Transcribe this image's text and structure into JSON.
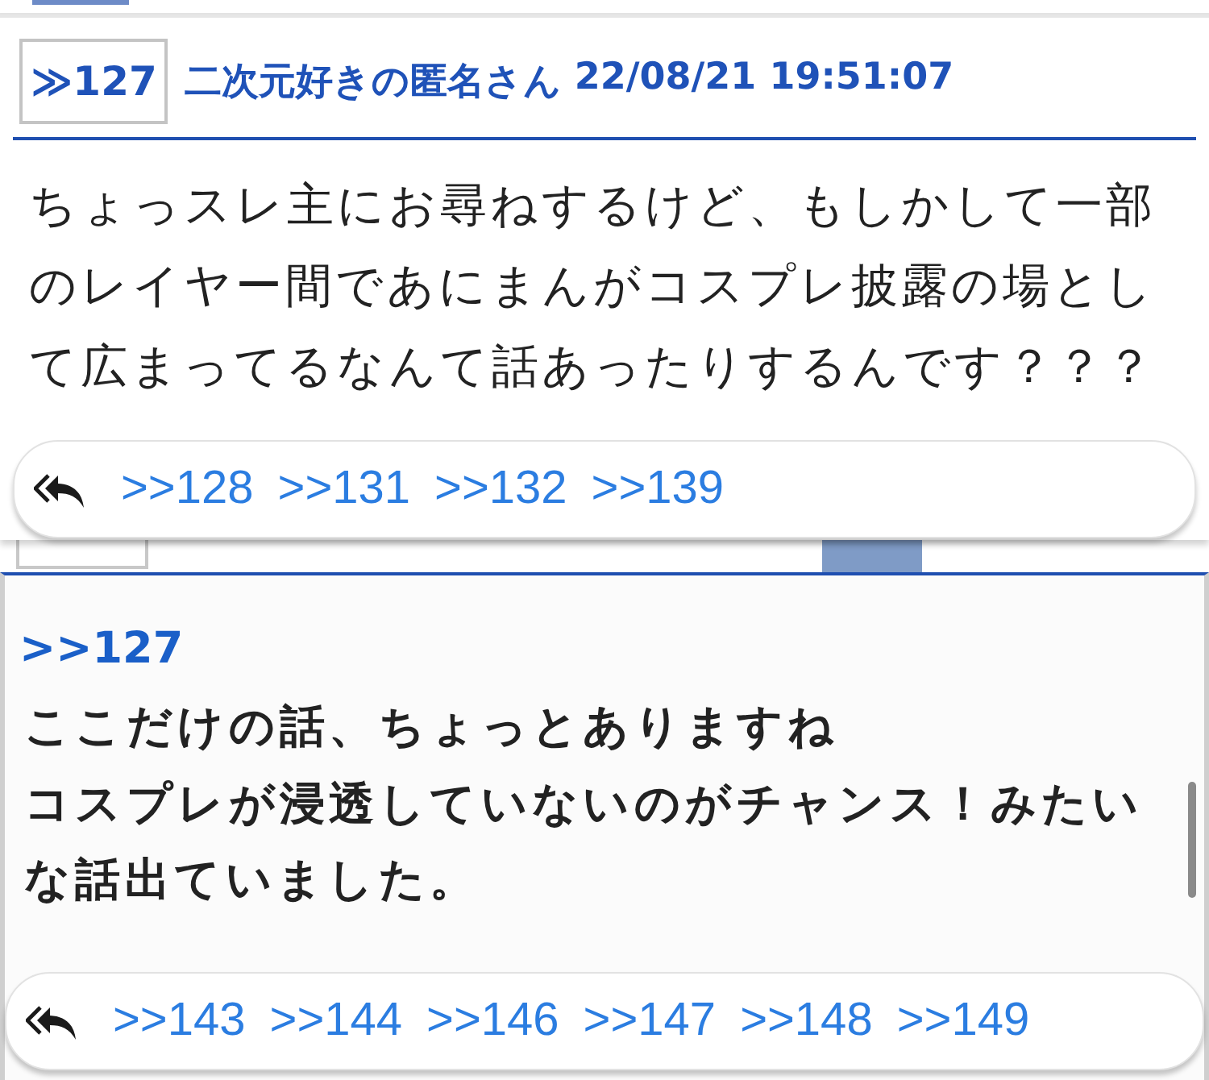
{
  "popup_post": {
    "number": "≫127",
    "author": "二次元好きの匿名さん",
    "date": "22/08/21 19:51:07",
    "body": "ちょっスレ主にお尋ねするけど、もしかして一部のレイヤー間であにまんがコスプレ披露の場として広まってるなんて話あったりするんです？？？",
    "replies": [
      ">>128",
      ">>131",
      ">>132",
      ">>139"
    ]
  },
  "post": {
    "anchor": ">>127",
    "lines": [
      "ここだけの話、ちょっとありますね",
      "コスプレが浸透していないのがチャンス！みたいな話出ていました。"
    ],
    "replies": [
      ">>143",
      ">>144",
      ">>146",
      ">>147",
      ">>148",
      ">>149"
    ]
  }
}
